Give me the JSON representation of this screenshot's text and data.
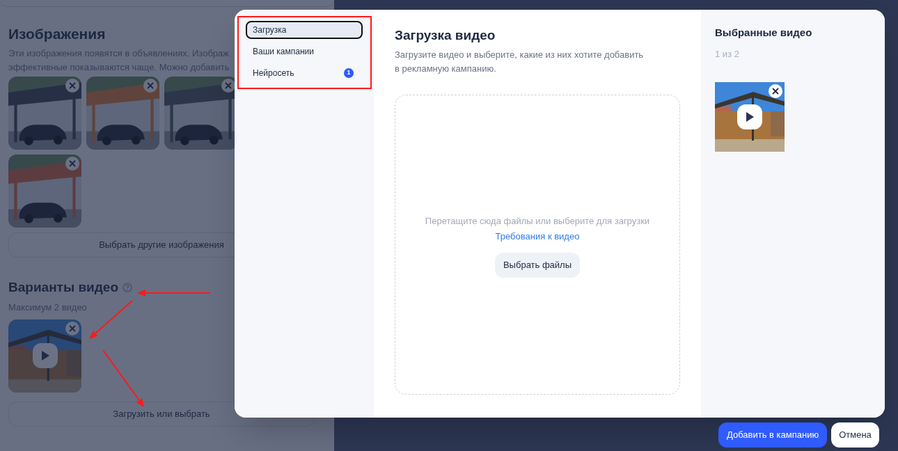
{
  "background_page": {
    "images_section": {
      "title": "Изображения",
      "description_lines": [
        "Эти изображения появятся в объявлениях. Изображ",
        "эффективные показываются чаще. Можно добавить"
      ],
      "images": [
        {
          "kind": "picture"
        },
        {
          "kind": "picture"
        },
        {
          "kind": "picture"
        },
        {
          "kind": "picture"
        }
      ],
      "button": "Выбрать другие изображения"
    },
    "video_section": {
      "title": "Варианты видео",
      "help_icon": true,
      "hint": "Максимум 2 видео",
      "videos": [
        {
          "kind": "video"
        }
      ],
      "button": "Загрузить или выбрать"
    }
  },
  "modal": {
    "nav": [
      {
        "label": "Загрузка",
        "selected": true
      },
      {
        "label": "Ваши кампании",
        "selected": false
      },
      {
        "label": "Нейросеть",
        "selected": false,
        "badge": "1"
      }
    ],
    "title": "Загрузка видео",
    "description_lines": [
      "Загрузите видео и выберите, какие из них хотите добавить",
      "в рекламную кампанию."
    ],
    "dropzone": {
      "hint": "Перетащите сюда файлы или выберите для загрузки",
      "link": "Требования к видео",
      "button": "Выбрать файлы"
    },
    "selected_panel": {
      "title": "Выбранные видео",
      "count": "1 из 2",
      "videos": [
        {
          "kind": "video"
        }
      ]
    }
  },
  "footer_buttons": [
    {
      "label": "Добавить в кампанию",
      "kind": "primary"
    },
    {
      "label": "Отмена",
      "kind": "secondary"
    }
  ],
  "annotations": {
    "frame": true
  }
}
